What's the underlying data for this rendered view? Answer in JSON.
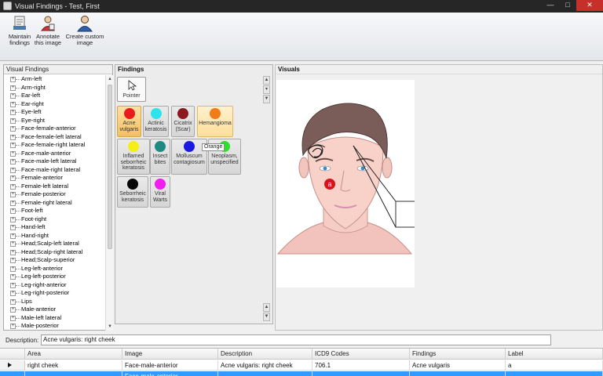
{
  "window": {
    "title": "Visual Findings - Test, First"
  },
  "toolbar": {
    "maintain_label": "Maintain findings",
    "annotate_label": "Annotate this image",
    "create_label": "Create custom image"
  },
  "visual_findings": {
    "header": "Visual Findings",
    "items": [
      "Arm-left",
      "Arm-right",
      "Ear-left",
      "Ear-right",
      "Eye-left",
      "Eye-right",
      "Face-female-anterior",
      "Face-female-left lateral",
      "Face-female-right lateral",
      "Face-male-anterior",
      "Face-male-left lateral",
      "Face-male-right lateral",
      "Female-anterior",
      "Female-left lateral",
      "Female-posterior",
      "Female-right lateral",
      "Foot-left",
      "Foot-right",
      "Hand-left",
      "Hand-right",
      "Head;Scalp-left lateral",
      "Head;Scalp-right lateral",
      "Head;Scalp-superior",
      "Leg-left-anterior",
      "Leg-left-posterior",
      "Leg-right-anterior",
      "Leg-right-posterior",
      "Lips",
      "Male-anterior",
      "Male-left lateral",
      "Male-posterior"
    ]
  },
  "findings": {
    "header": "Findings",
    "pointer_label": "Pointer",
    "tooltip": "Orange",
    "buttons": [
      {
        "label": "Acne vulgaris",
        "color": "#e81c1c",
        "state": "selected"
      },
      {
        "label": "Actinic keratosis",
        "color": "#2de4ec",
        "state": "normal"
      },
      {
        "label": "Cicatrix (Scar)",
        "color": "#8b1a20",
        "state": "normal"
      },
      {
        "label": "Hemangioma",
        "color": "#f27a18",
        "state": "hover"
      },
      {
        "label": "Inflamed seborrheic keratosis",
        "color": "#f4ee16",
        "state": "normal"
      },
      {
        "label": "Insect bites",
        "color": "#1f8a82",
        "state": "normal"
      },
      {
        "label": "Molluscum contagiosum",
        "color": "#1a1ae0",
        "state": "normal"
      },
      {
        "label": "Neoplasm, unspecified",
        "color": "#2ce02c",
        "state": "normal"
      },
      {
        "label": "Seborrheic keratosis",
        "color": "#050505",
        "state": "normal"
      },
      {
        "label": "Viral Warts",
        "color": "#f01cf0",
        "state": "normal"
      }
    ]
  },
  "visuals": {
    "header": "Visuals",
    "marker_label": "a"
  },
  "description": {
    "label": "Description:",
    "value": "Acne vulgaris: right cheek"
  },
  "grid": {
    "columns": [
      "Area",
      "Image",
      "Description",
      "ICD9 Codes",
      "Findings",
      "Label"
    ],
    "rows": [
      [
        "right cheek",
        "Face-male-anterior",
        "Acne vulgaris: right cheek",
        "706.1",
        "Acne vulgaris",
        "a"
      ],
      [
        "",
        "Face-male-anterior",
        "",
        "",
        "",
        ""
      ]
    ]
  }
}
